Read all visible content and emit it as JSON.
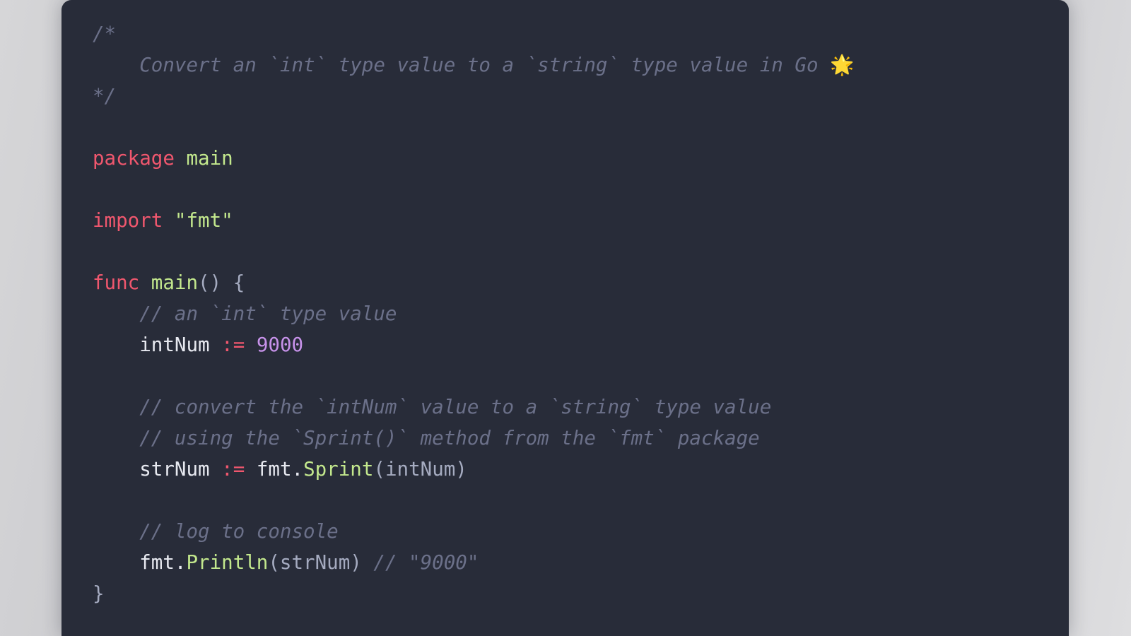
{
  "card": {
    "background_color": "#282c39",
    "page_background_color": "#c2c2c6"
  },
  "theme": {
    "comment_color": "#6b7089",
    "keyword_color": "#f0576e",
    "function_color": "#c3e88d",
    "string_color": "#c3e88d",
    "number_color": "#c792ea",
    "variable_color": "#e7e9f0",
    "punctuation_color": "#a5abc0"
  },
  "code": {
    "language": "go",
    "emoji": "🌟",
    "lines": [
      {
        "id": "l1",
        "type": "comment",
        "text": "/*"
      },
      {
        "id": "l2",
        "type": "comment",
        "indent": 1,
        "text": "Convert an `int` type value to a `string` type value in Go ",
        "emoji": "🌟"
      },
      {
        "id": "l3",
        "type": "comment",
        "text": "*/"
      },
      {
        "id": "l4",
        "type": "blank",
        "text": ""
      },
      {
        "id": "l5",
        "type": "code",
        "text": "package main",
        "kw": "package",
        "ident": "main"
      },
      {
        "id": "l6",
        "type": "blank",
        "text": ""
      },
      {
        "id": "l7",
        "type": "code",
        "text": "import \"fmt\"",
        "kw": "import",
        "string": "\"fmt\""
      },
      {
        "id": "l8",
        "type": "blank",
        "text": ""
      },
      {
        "id": "l9",
        "type": "code",
        "text": "func main() {",
        "kw": "func",
        "ident": "main",
        "punct": "() {"
      },
      {
        "id": "l10",
        "type": "comment",
        "indent": 1,
        "text": "// an `int` type value"
      },
      {
        "id": "l11",
        "type": "code",
        "indent": 1,
        "text": "intNum := 9000",
        "var": "intNum",
        "op": ":=",
        "num": "9000"
      },
      {
        "id": "l12",
        "type": "blank",
        "text": ""
      },
      {
        "id": "l13",
        "type": "comment",
        "indent": 1,
        "text": "// convert the `intNum` value to a `string` type value"
      },
      {
        "id": "l14",
        "type": "comment",
        "indent": 1,
        "text": "// using the `Sprint()` method from the `fmt` package"
      },
      {
        "id": "l15",
        "type": "code",
        "indent": 1,
        "text": "strNum := fmt.Sprint(intNum)",
        "var": "strNum",
        "op": ":=",
        "pkg": "fmt.",
        "fn": "Sprint",
        "args": "(intNum)"
      },
      {
        "id": "l16",
        "type": "blank",
        "text": ""
      },
      {
        "id": "l17",
        "type": "comment",
        "indent": 1,
        "text": "// log to console"
      },
      {
        "id": "l18",
        "type": "code",
        "indent": 1,
        "text": "fmt.Println(strNum) // \"9000\"",
        "pkg": "fmt.",
        "fn": "Println",
        "args": "(strNum)",
        "trailing_comment": "// \"9000\""
      },
      {
        "id": "l19",
        "type": "code",
        "text": "}",
        "punct": "}"
      }
    ],
    "tokens": {
      "line1_comment_open": "/*",
      "line2_indent": "    ",
      "line2_body": "Convert an `int` type value to a `string` type value in Go ",
      "line3_comment_close": "*/",
      "package_kw": "package",
      "package_name": "main",
      "import_kw": "import",
      "import_path": "\"fmt\"",
      "func_kw": "func",
      "func_name": "main",
      "func_sig_tail": "() {",
      "indent1": "    ",
      "comment_int_value": "// an `int` type value",
      "intnum_var": "intNum",
      "assign_op": ":=",
      "intnum_value": "9000",
      "comment_convert": "// convert the `intNum` value to a `string` type value",
      "comment_using": "// using the `Sprint()` method from the `fmt` package",
      "strnum_var": "strNum",
      "fmt_pkg": "fmt",
      "dot": ".",
      "sprint_fn": "Sprint",
      "sprint_args": "(intNum)",
      "comment_log": "// log to console",
      "println_fn": "Println",
      "println_args": "(strNum)",
      "output_comment": "// \"9000\"",
      "closing_brace": "}"
    }
  }
}
